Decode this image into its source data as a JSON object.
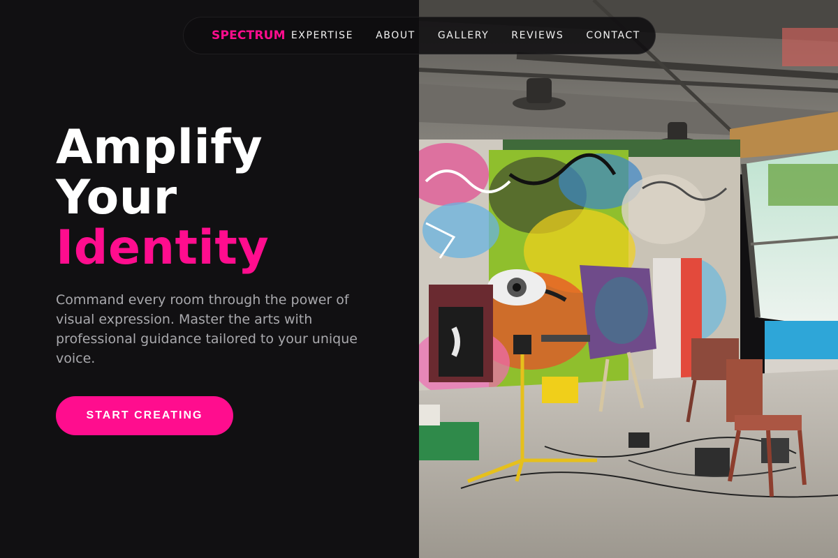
{
  "nav": {
    "brand": "SPECTRUM",
    "links": [
      "EXPERTISE",
      "ABOUT",
      "GALLERY",
      "REVIEWS",
      "CONTACT"
    ]
  },
  "hero": {
    "line1": "Amplify",
    "line2": "Your",
    "line3": "Identity",
    "subtitle": "Command every room through the power of visual expression. Master the arts with professional guidance tailored to your unique voice.",
    "cta": "START CREATING"
  },
  "colors": {
    "accent": "#ff0d8e",
    "background": "#111012",
    "text": "#ffffff",
    "muted": "#a9a9ad"
  }
}
